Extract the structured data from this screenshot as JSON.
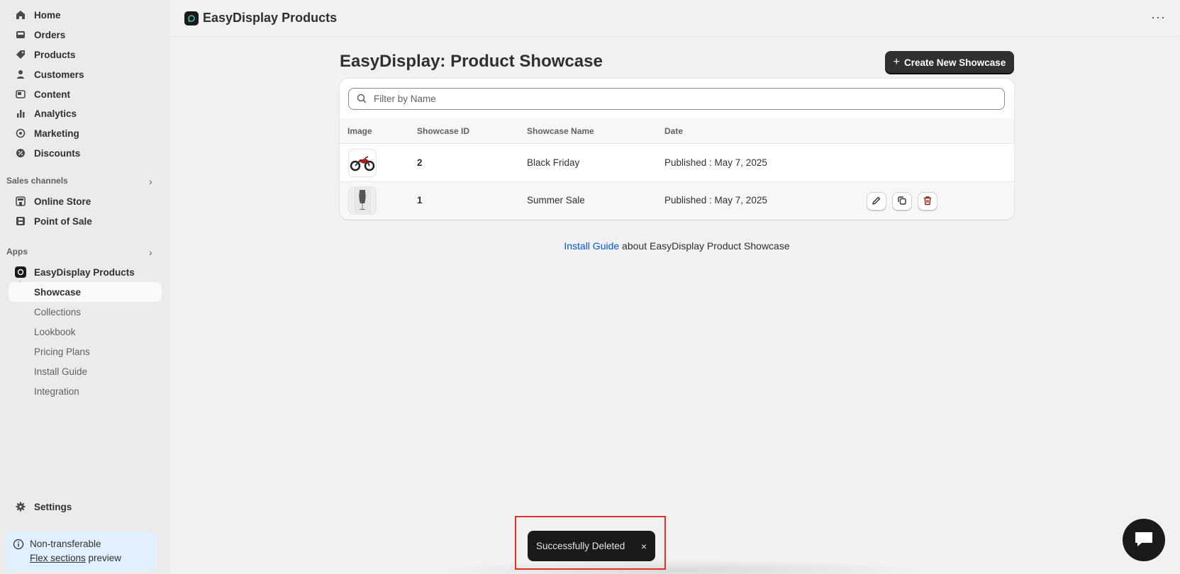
{
  "sidebar": {
    "nav": [
      {
        "label": "Home",
        "icon": "home-icon"
      },
      {
        "label": "Orders",
        "icon": "inbox-icon"
      },
      {
        "label": "Products",
        "icon": "tag-icon"
      },
      {
        "label": "Customers",
        "icon": "person-icon"
      },
      {
        "label": "Content",
        "icon": "content-icon"
      },
      {
        "label": "Analytics",
        "icon": "bar-chart-icon"
      },
      {
        "label": "Marketing",
        "icon": "target-icon"
      },
      {
        "label": "Discounts",
        "icon": "discount-icon"
      }
    ],
    "sales_channels_title": "Sales channels",
    "sales_channels": [
      {
        "label": "Online Store",
        "icon": "store-icon"
      },
      {
        "label": "Point of Sale",
        "icon": "pos-icon"
      }
    ],
    "apps_title": "Apps",
    "app_name": "EasyDisplay Products",
    "app_subitems": [
      "Showcase",
      "Collections",
      "Lookbook",
      "Pricing Plans",
      "Install Guide",
      "Integration"
    ],
    "settings_label": "Settings",
    "notice": {
      "line1": "Non-transferable",
      "link": "Flex sections",
      "line2_rest": " preview"
    }
  },
  "topbar": {
    "title": "EasyDisplay Products",
    "more": "···"
  },
  "main": {
    "title": "EasyDisplay: Product Showcase",
    "create_button": "Create New Showcase",
    "search_placeholder": "Filter by Name",
    "columns": [
      "Image",
      "Showcase ID",
      "Showcase Name",
      "Date"
    ],
    "rows": [
      {
        "id": "2",
        "name": "Black Friday",
        "date": "Published : May 7, 2025",
        "image": "motorcycle"
      },
      {
        "id": "1",
        "name": "Summer Sale",
        "date": "Published : May 7, 2025",
        "image": "mannequin"
      }
    ],
    "guide_link": "Install Guide",
    "guide_rest": " about EasyDisplay Product Showcase"
  },
  "toast": {
    "message": "Successfully Deleted",
    "close": "×"
  },
  "colors": {
    "accent": "#303030",
    "link": "#005bd3",
    "highlight": "#e0302a"
  }
}
